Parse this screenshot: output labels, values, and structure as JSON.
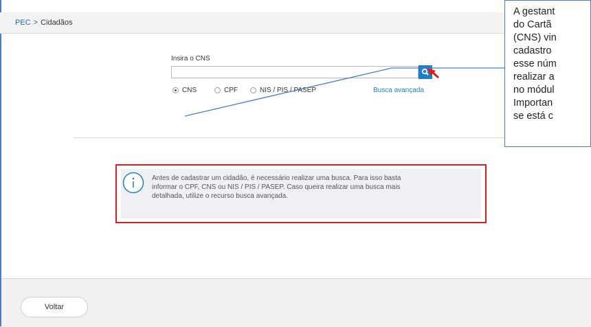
{
  "breadcrumb": {
    "root": "PEC",
    "separator": ">",
    "current": "Cidadãos"
  },
  "search": {
    "label": "Insira o CNS",
    "value": "",
    "placeholder": ""
  },
  "radios": [
    {
      "label": "CNS",
      "selected": true
    },
    {
      "label": "CPF",
      "selected": false
    },
    {
      "label": "NIS / PIS / PASEP",
      "selected": false
    }
  ],
  "advanced_search": "Busca avançada",
  "alert": {
    "line1": "Antes de cadastrar um cidadão, é necessário realizar uma busca. Para isso basta",
    "line2": "informar o CPF, CNS ou NIS / PIS / PASEP. Caso queira realizar uma busca mais",
    "line3": "detalhada, utilize o recurso busca avançada."
  },
  "back_button": "Voltar",
  "callout": {
    "lines": [
      "A gestant",
      "do Cartã",
      "(CNS) vin",
      "cadastro",
      "esse núm",
      "realizar a",
      "no módul",
      "Importan",
      "se está c"
    ]
  },
  "colors": {
    "accent": "#1f7fc6",
    "highlight": "#e21a1a",
    "callout_border": "#4b7cc1"
  },
  "icons": {
    "search": "magnifier-icon",
    "info": "info-icon",
    "pointer": "red-arrow-icon"
  }
}
